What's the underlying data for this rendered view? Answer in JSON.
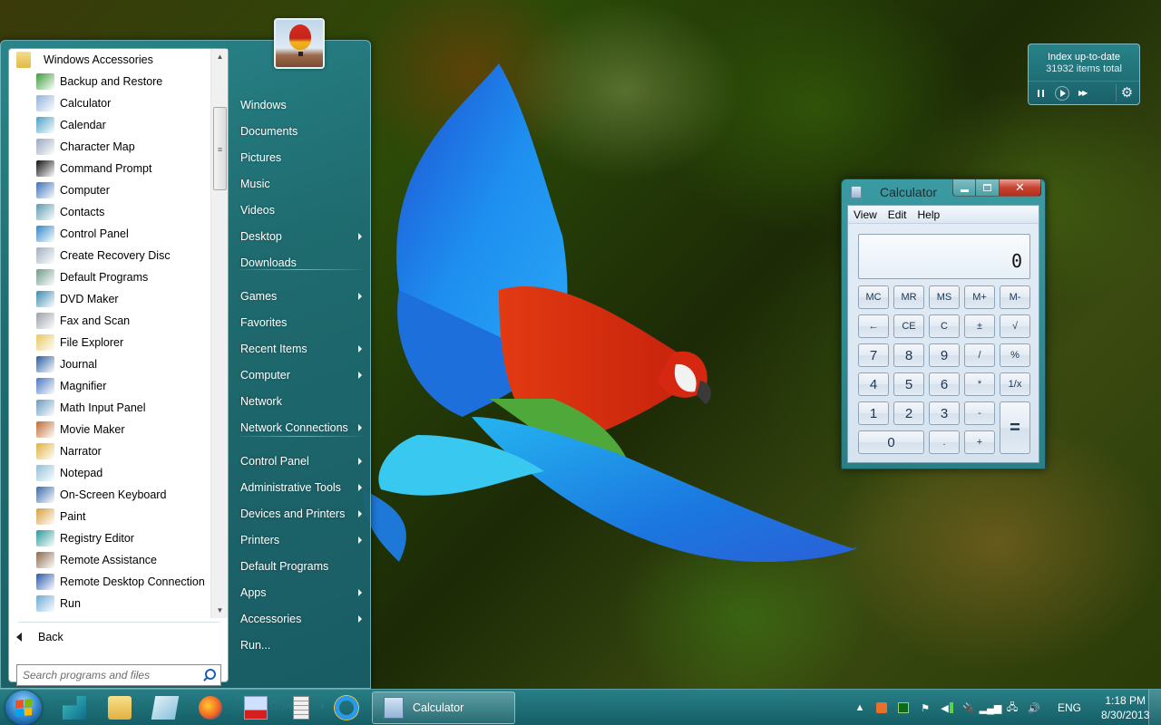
{
  "start_menu": {
    "programs_folder": "Windows Accessories",
    "programs": [
      {
        "label": "Backup and Restore",
        "icon": "backup-restore-icon",
        "color": "#3a9c3a"
      },
      {
        "label": "Calculator",
        "icon": "calculator-icon",
        "color": "#8fb3d9"
      },
      {
        "label": "Calendar",
        "icon": "calendar-icon",
        "color": "#4aa0c8"
      },
      {
        "label": "Character Map",
        "icon": "character-map-icon",
        "color": "#9aa8c0"
      },
      {
        "label": "Command Prompt",
        "icon": "command-prompt-icon",
        "color": "#111111"
      },
      {
        "label": "Computer",
        "icon": "computer-icon",
        "color": "#3c6fb8"
      },
      {
        "label": "Contacts",
        "icon": "contacts-icon",
        "color": "#5a9ab0"
      },
      {
        "label": "Control Panel",
        "icon": "control-panel-icon",
        "color": "#2f86c8"
      },
      {
        "label": "Create Recovery Disc",
        "icon": "recovery-disc-icon",
        "color": "#a0b0c0"
      },
      {
        "label": "Default Programs",
        "icon": "default-programs-icon",
        "color": "#6f9a8a"
      },
      {
        "label": "DVD Maker",
        "icon": "dvd-maker-icon",
        "color": "#3a8ab0"
      },
      {
        "label": "Fax and Scan",
        "icon": "fax-scan-icon",
        "color": "#9aa0a8"
      },
      {
        "label": "File Explorer",
        "icon": "file-explorer-icon",
        "color": "#e8c860"
      },
      {
        "label": "Journal",
        "icon": "journal-icon",
        "color": "#2a5c9c"
      },
      {
        "label": "Magnifier",
        "icon": "magnifier-icon",
        "color": "#4a78c0"
      },
      {
        "label": "Math Input Panel",
        "icon": "math-input-icon",
        "color": "#6a9ac0"
      },
      {
        "label": "Movie Maker",
        "icon": "movie-maker-icon",
        "color": "#c06a30"
      },
      {
        "label": "Narrator",
        "icon": "narrator-icon",
        "color": "#e0b040"
      },
      {
        "label": "Notepad",
        "icon": "notepad-icon",
        "color": "#8ec0d8"
      },
      {
        "label": "On-Screen Keyboard",
        "icon": "on-screen-keyboard-icon",
        "color": "#3a6aa8"
      },
      {
        "label": "Paint",
        "icon": "paint-icon",
        "color": "#d8a040"
      },
      {
        "label": "Registry Editor",
        "icon": "registry-editor-icon",
        "color": "#2a9a9a"
      },
      {
        "label": "Remote Assistance",
        "icon": "remote-assistance-icon",
        "color": "#8a6a4a"
      },
      {
        "label": "Remote Desktop Connection",
        "icon": "remote-desktop-icon",
        "color": "#2a58a8"
      },
      {
        "label": "Run",
        "icon": "run-icon",
        "color": "#6aaad8"
      }
    ],
    "back_label": "Back",
    "search_placeholder": "Search programs and files",
    "right_items": [
      {
        "label": "Windows",
        "submenu": false
      },
      {
        "label": "Documents",
        "submenu": false
      },
      {
        "label": "Pictures",
        "submenu": false
      },
      {
        "label": "Music",
        "submenu": false
      },
      {
        "label": "Videos",
        "submenu": false
      },
      {
        "label": "Desktop",
        "submenu": true
      },
      {
        "label": "Downloads",
        "submenu": false
      },
      {
        "label": "Games",
        "submenu": true
      },
      {
        "label": "Favorites",
        "submenu": false
      },
      {
        "label": "Recent Items",
        "submenu": true
      },
      {
        "label": "Computer",
        "submenu": true
      },
      {
        "label": "Network",
        "submenu": false
      },
      {
        "label": "Network Connections",
        "submenu": true
      },
      {
        "label": "Control Panel",
        "submenu": true
      },
      {
        "label": "Administrative Tools",
        "submenu": true
      },
      {
        "label": "Devices and Printers",
        "submenu": true
      },
      {
        "label": "Printers",
        "submenu": true
      },
      {
        "label": "Default Programs",
        "submenu": false
      },
      {
        "label": "Apps",
        "submenu": true
      },
      {
        "label": "Accessories",
        "submenu": true
      },
      {
        "label": "Run...",
        "submenu": false
      }
    ],
    "shutdown_label": "Shut Down..."
  },
  "gadget": {
    "title": "Index up-to-date",
    "subtitle": "31932 items total"
  },
  "calculator": {
    "title": "Calculator",
    "menu": [
      "View",
      "Edit",
      "Help"
    ],
    "display": "0",
    "keys": [
      [
        "MC",
        "MR",
        "MS",
        "M+",
        "M-"
      ],
      [
        "←",
        "CE",
        "C",
        "±",
        "√"
      ],
      [
        "7",
        "8",
        "9",
        "/",
        "%"
      ],
      [
        "4",
        "5",
        "6",
        "*",
        "1/x"
      ],
      [
        "1",
        "2",
        "3",
        "-",
        "="
      ],
      [
        "0",
        ".",
        "+"
      ]
    ]
  },
  "taskbar": {
    "pinned": [
      {
        "name": "registry-editor-pinned",
        "icon": "registry-editor-icon"
      },
      {
        "name": "file-explorer-pinned",
        "icon": "file-explorer-icon"
      },
      {
        "name": "notepad-pinned",
        "icon": "notepad-icon"
      },
      {
        "name": "firefox-pinned",
        "icon": "firefox-icon"
      },
      {
        "name": "pdf-viewer-pinned",
        "icon": "pdf-icon"
      },
      {
        "name": "task-list-pinned",
        "icon": "task-list-icon"
      },
      {
        "name": "internet-explorer-pinned",
        "icon": "internet-explorer-icon"
      }
    ],
    "active_task": "Calculator",
    "language": "ENG",
    "time": "1:18 PM",
    "date": "8/30/2013"
  }
}
